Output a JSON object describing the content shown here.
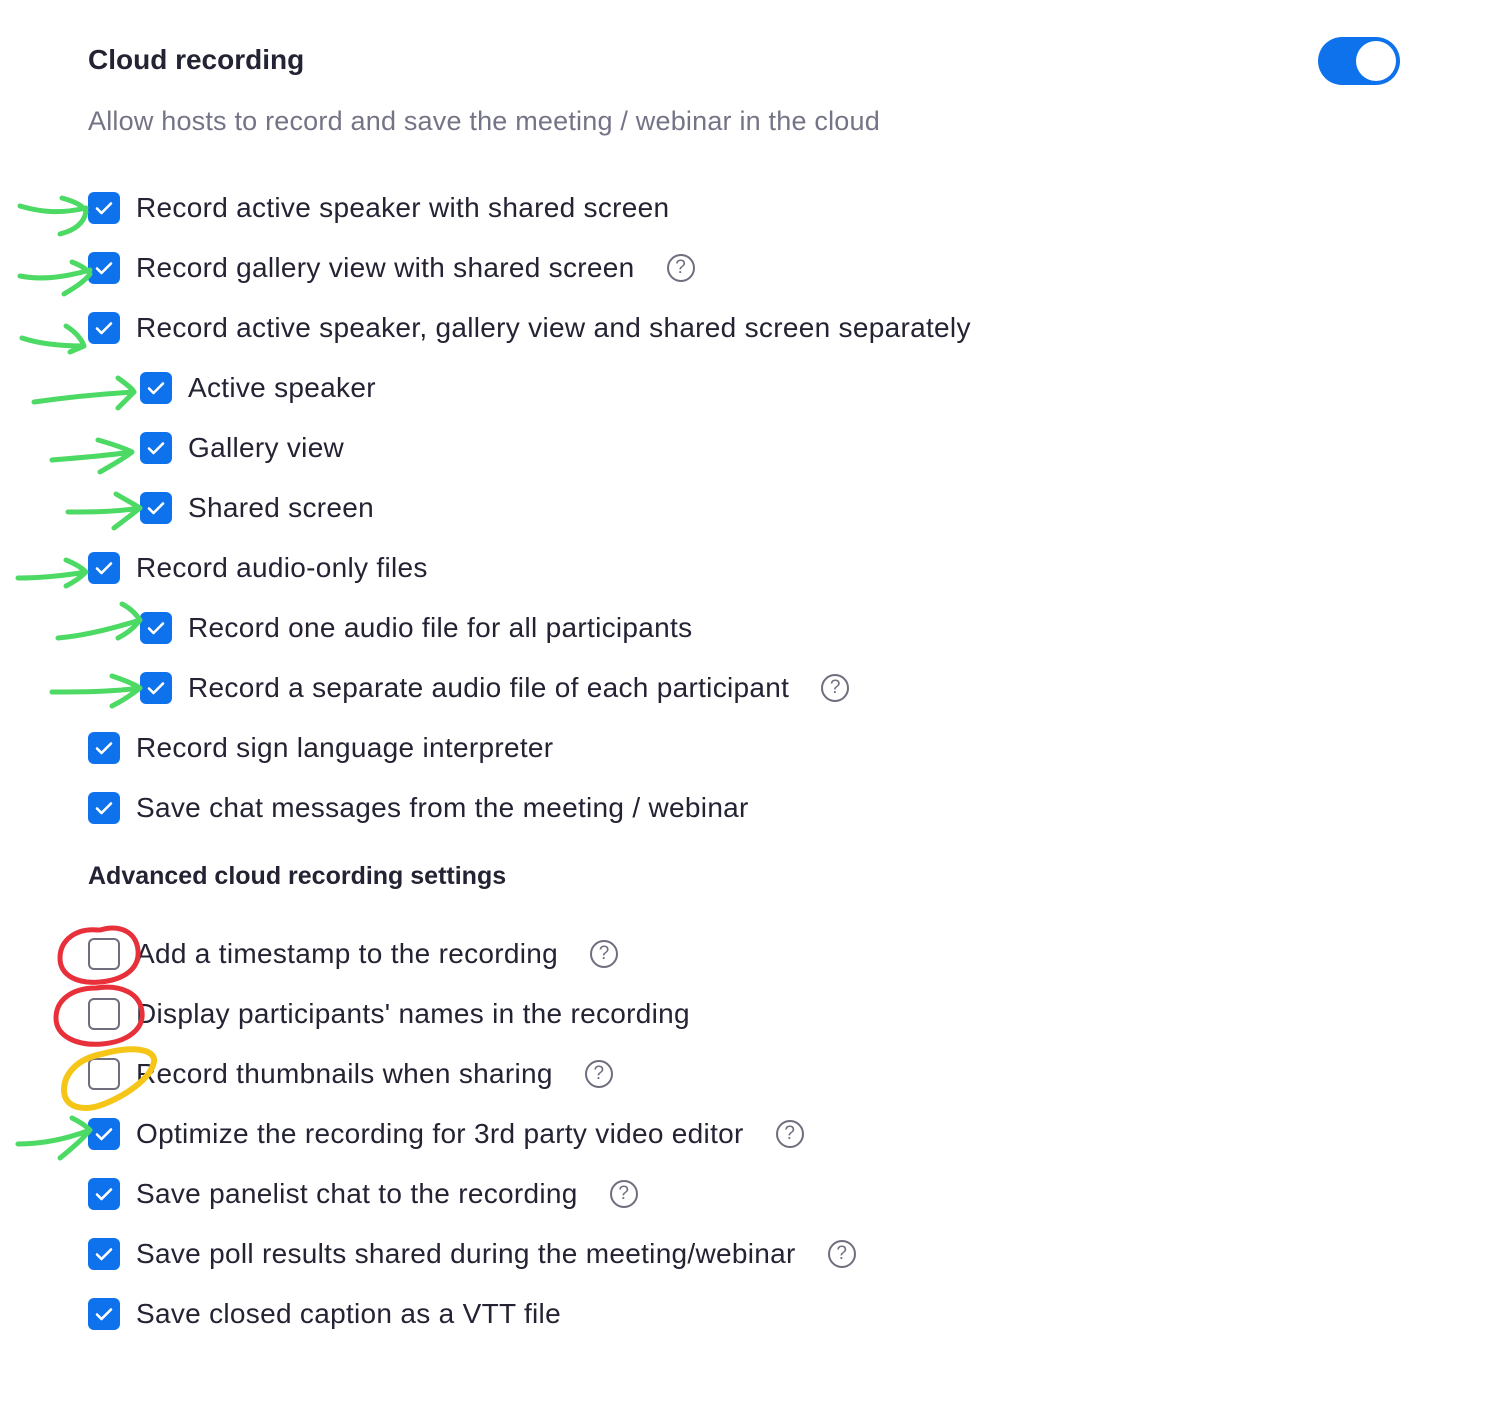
{
  "header": {
    "title": "Cloud recording",
    "description": "Allow hosts to record and save the meeting / webinar in the cloud",
    "toggle_on": true
  },
  "options": [
    {
      "label": "Record active speaker with shared screen",
      "checked": true
    },
    {
      "label": "Record gallery view with shared screen",
      "checked": true,
      "help": "?"
    },
    {
      "label": "Record active speaker, gallery view and shared screen separately",
      "checked": true
    },
    {
      "label": "Active speaker",
      "checked": true
    },
    {
      "label": "Gallery view",
      "checked": true
    },
    {
      "label": "Shared screen",
      "checked": true
    },
    {
      "label": "Record audio-only files",
      "checked": true
    },
    {
      "label": "Record one audio file for all participants",
      "checked": true
    },
    {
      "label": "Record a separate audio file of each participant",
      "checked": true,
      "help": "?"
    },
    {
      "label": "Record sign language interpreter",
      "checked": true
    },
    {
      "label": "Save chat messages from the meeting / webinar",
      "checked": true
    }
  ],
  "advanced": {
    "title": "Advanced cloud recording settings",
    "options": [
      {
        "label": "Add a timestamp to the recording",
        "checked": false,
        "help": "?"
      },
      {
        "label": "Display participants' names in the recording",
        "checked": false
      },
      {
        "label": "Record thumbnails when sharing",
        "checked": false,
        "help": "?"
      },
      {
        "label": "Optimize the recording for 3rd party video editor",
        "checked": true,
        "help": "?"
      },
      {
        "label": "Save panelist chat to the recording",
        "checked": true,
        "help": "?"
      },
      {
        "label": "Save poll results shared during the meeting/webinar",
        "checked": true,
        "help": "?"
      },
      {
        "label": "Save closed caption as a VTT file",
        "checked": true
      }
    ]
  },
  "colors": {
    "accent": "#0e72ed",
    "annotation_green": "#4cd964",
    "annotation_red": "#e8303a",
    "annotation_yellow": "#f5c518"
  }
}
